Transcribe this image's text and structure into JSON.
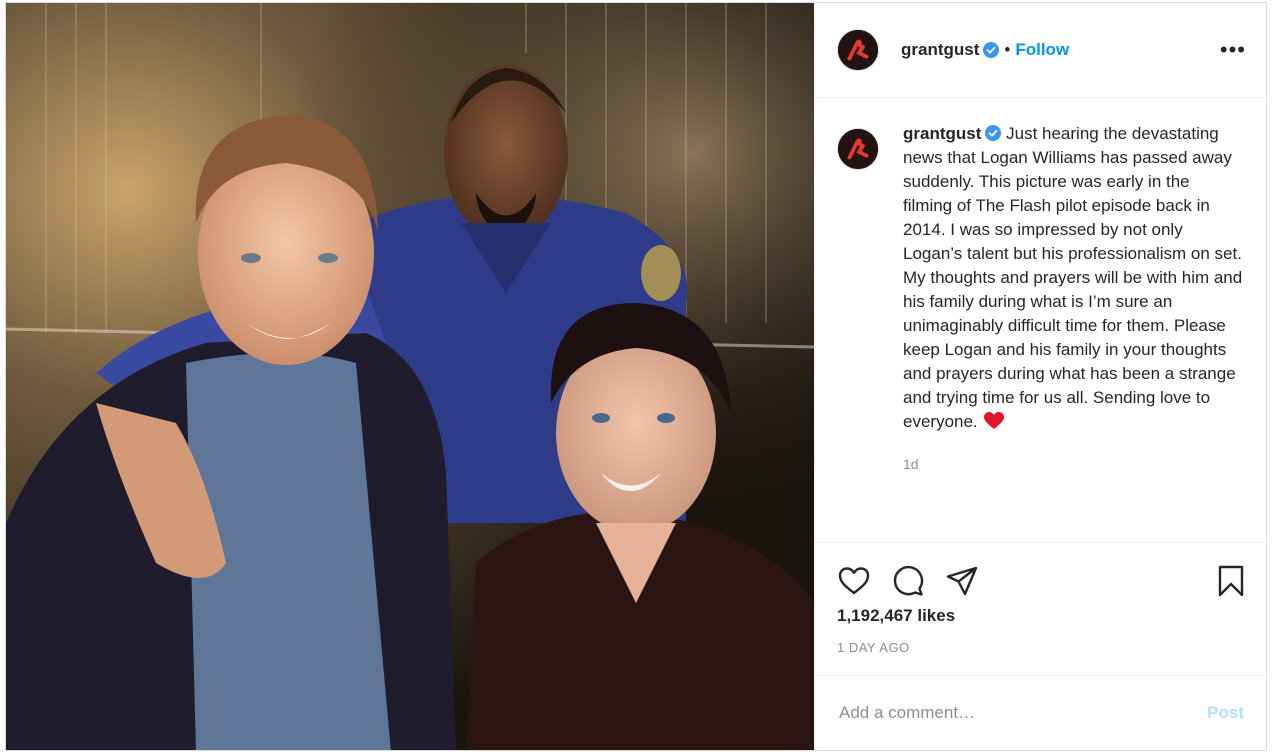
{
  "post": {
    "author": "grantgust",
    "follow_label": "Follow",
    "separator": "•",
    "more_label": "•••",
    "caption_text": "Just hearing the devastating news that Logan Williams has passed away suddenly. This picture was early in the filming of The Flash pilot episode back in 2014. I was so impressed by not only Logan’s talent but his professionalism on set. My thoughts and prayers will be with him and his family during what is I’m sure an unimaginably difficult time for them. Please keep Logan and his family in your thoughts and prayers during what has been a strange and trying time for us all. Sending love to everyone.",
    "caption_time": "1d",
    "likes": "1,192,467 likes",
    "timestamp": "1 DAY AGO",
    "comment_placeholder": "Add a comment…",
    "post_label": "Post"
  },
  "icons": {
    "verified": "verified-badge-icon",
    "like": "heart-outline-icon",
    "comment": "comment-bubble-icon",
    "share": "paper-plane-icon",
    "save": "bookmark-icon",
    "emoji": "red-heart-emoji"
  },
  "colors": {
    "follow": "#0095f6",
    "post_disabled": "#b2dffc",
    "muted": "#8e8e8e",
    "verified": "#3897f0",
    "heart_emoji": "#e0162b"
  }
}
